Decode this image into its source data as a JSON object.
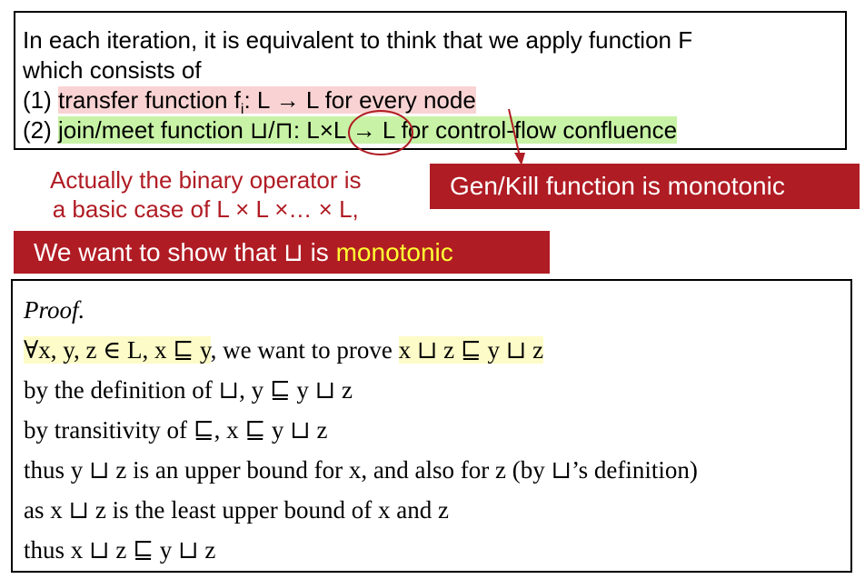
{
  "top": {
    "line1": "In each iteration, it is equivalent to think that we apply function F",
    "line2": "which consists of",
    "item1_num": "(1)",
    "item1_a": "transfer function f",
    "item1_sub": "i",
    "item1_b": ": L → L for every node",
    "item2_num": "(2)",
    "item2_a": "join/meet function ⊔/⊓: ",
    "item2_b": "L×L",
    "item2_c": "→ L for control-flow confluence"
  },
  "annotation": {
    "line1": "Actually the binary operator is",
    "line2": "a basic case of L × L ×… × L,"
  },
  "genkill_banner": "Gen/Kill function is monotonic",
  "want_banner": {
    "prefix": "We want to show that ⊔ is ",
    "highlight": "monotonic"
  },
  "proof": {
    "title": "Proof.",
    "line1_a": "∀x, y, z ∈ L, x ⊑ y",
    "line1_b": ", we want to prove ",
    "line1_c": "x ⊔ z ⊑ y ⊔ z",
    "line2": "by the definition of ⊔, y ⊑ y ⊔ z",
    "line3": "by transitivity of ⊑, x ⊑ y ⊔ z",
    "line4": "thus y ⊔ z is an upper bound for x, and also for z (by ⊔’s definition)",
    "line5": "as x ⊔ z is the least upper bound of x and z",
    "line6": "thus x ⊔ z ⊑ y ⊔ z"
  },
  "colors": {
    "accent_red": "#b01c24",
    "highlight_pink": "#f9d3d3",
    "highlight_green": "#c8f3a6",
    "highlight_yellow": "#fdfbc8",
    "banner_yellow_text": "#ffff33"
  }
}
